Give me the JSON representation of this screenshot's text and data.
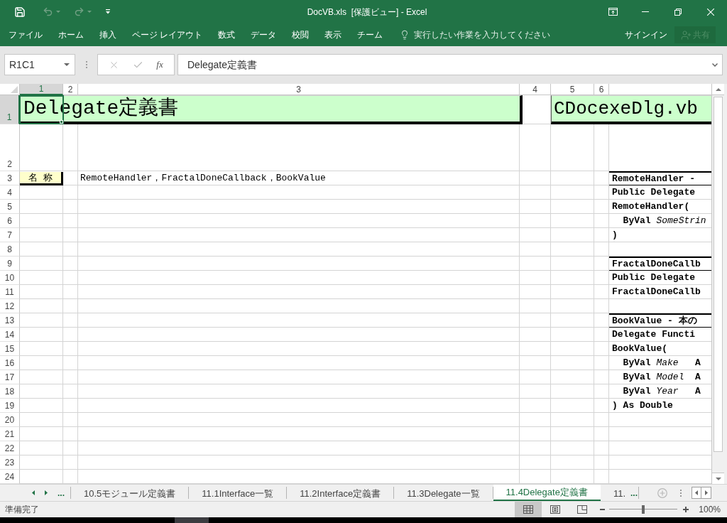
{
  "title_bar": {
    "title": "DocVB.xls  [保護ビュー] - Excel",
    "quick_access": [
      {
        "kind": "save",
        "disabled": false
      },
      {
        "kind": "undo",
        "disabled": true
      },
      {
        "kind": "redo",
        "disabled": true
      },
      {
        "kind": "customize",
        "disabled": false
      }
    ]
  },
  "ribbon": {
    "tabs": [
      {
        "label": "ファイル"
      },
      {
        "label": "ホーム"
      },
      {
        "label": "挿入"
      },
      {
        "label": "ページ レイアウト"
      },
      {
        "label": "数式"
      },
      {
        "label": "データ"
      },
      {
        "label": "校閲"
      },
      {
        "label": "表示"
      },
      {
        "label": "チーム"
      }
    ],
    "tell_me": {
      "placeholder": "実行したい作業を入力してください"
    },
    "sign_in": "サインイン",
    "share": {
      "label": "共有",
      "disabled": true
    }
  },
  "formula_bar": {
    "name_box": "R1C1",
    "function_label": "fx",
    "formula": "Delegate定義書"
  },
  "sheet": {
    "columns": [
      {
        "label": "1",
        "selected": true
      },
      {
        "label": "2",
        "selected": false
      },
      {
        "label": "3",
        "selected": false
      },
      {
        "label": "4",
        "selected": false
      },
      {
        "label": "5",
        "selected": false
      },
      {
        "label": "6",
        "selected": false
      }
    ],
    "rows": [
      {
        "label": "1",
        "selected": true
      },
      {
        "label": "2",
        "selected": false
      },
      {
        "label": "3",
        "selected": false
      },
      {
        "label": "4",
        "selected": false
      },
      {
        "label": "5",
        "selected": false
      },
      {
        "label": "6",
        "selected": false
      },
      {
        "label": "7",
        "selected": false
      },
      {
        "label": "8",
        "selected": false
      },
      {
        "label": "9",
        "selected": false
      },
      {
        "label": "10",
        "selected": false
      },
      {
        "label": "11",
        "selected": false
      },
      {
        "label": "12",
        "selected": false
      },
      {
        "label": "13",
        "selected": false
      },
      {
        "label": "14",
        "selected": false
      },
      {
        "label": "15",
        "selected": false
      },
      {
        "label": "16",
        "selected": false
      },
      {
        "label": "17",
        "selected": false
      },
      {
        "label": "18",
        "selected": false
      },
      {
        "label": "19",
        "selected": false
      },
      {
        "label": "20",
        "selected": false
      },
      {
        "label": "21",
        "selected": false
      },
      {
        "label": "22",
        "selected": false
      },
      {
        "label": "23",
        "selected": false
      },
      {
        "label": "24",
        "selected": false
      }
    ],
    "title": "Delegate定義書",
    "file_title": "CDocexeDlg.vb",
    "name_label": "名 称",
    "name_value": "RemoteHandler，FractalDoneCallback，BookValue",
    "code_lines": [
      {
        "kind": "heading",
        "text": "RemoteHandler -"
      },
      {
        "kind": "line",
        "text": "Public Delegate"
      },
      {
        "kind": "line",
        "text": "RemoteHandler("
      },
      {
        "kind": "line",
        "text": "  ByVal *SomeStrin*"
      },
      {
        "kind": "line",
        "text": ")"
      },
      {
        "kind": "blank"
      },
      {
        "kind": "heading",
        "text": "FractalDoneCallb"
      },
      {
        "kind": "line",
        "text": "Public Delegate"
      },
      {
        "kind": "line",
        "text": "FractalDoneCallb"
      },
      {
        "kind": "blank"
      },
      {
        "kind": "heading",
        "text": "BookValue - 本の"
      },
      {
        "kind": "line",
        "text": "Delegate Functi"
      },
      {
        "kind": "line",
        "text": "BookValue("
      },
      {
        "kind": "line",
        "text": "  ByVal *Make*   A"
      },
      {
        "kind": "line",
        "text": "  ByVal *Model*  A"
      },
      {
        "kind": "line",
        "text": "  ByVal *Year*   A"
      },
      {
        "kind": "line",
        "text": ") As Double"
      }
    ]
  },
  "sheet_tabs": {
    "more_left": "...",
    "tabs": [
      {
        "label": "10.5モジュール定義書",
        "selected": false
      },
      {
        "label": "11.1Interface一覧",
        "selected": false
      },
      {
        "label": "11.2Interface定義書",
        "selected": false
      },
      {
        "label": "11.3Delegate一覧",
        "selected": false
      },
      {
        "label": "11.4Delegate定義書",
        "selected": true
      },
      {
        "label": "11.",
        "selected": false
      }
    ],
    "more_right": "..."
  },
  "status_bar": {
    "status": "準備完了",
    "views": [
      {
        "kind": "normal",
        "selected": true
      },
      {
        "kind": "page_layout",
        "selected": false
      },
      {
        "kind": "page_break",
        "selected": false
      }
    ],
    "zoom": {
      "level": 0.5,
      "reading": "100%"
    }
  }
}
